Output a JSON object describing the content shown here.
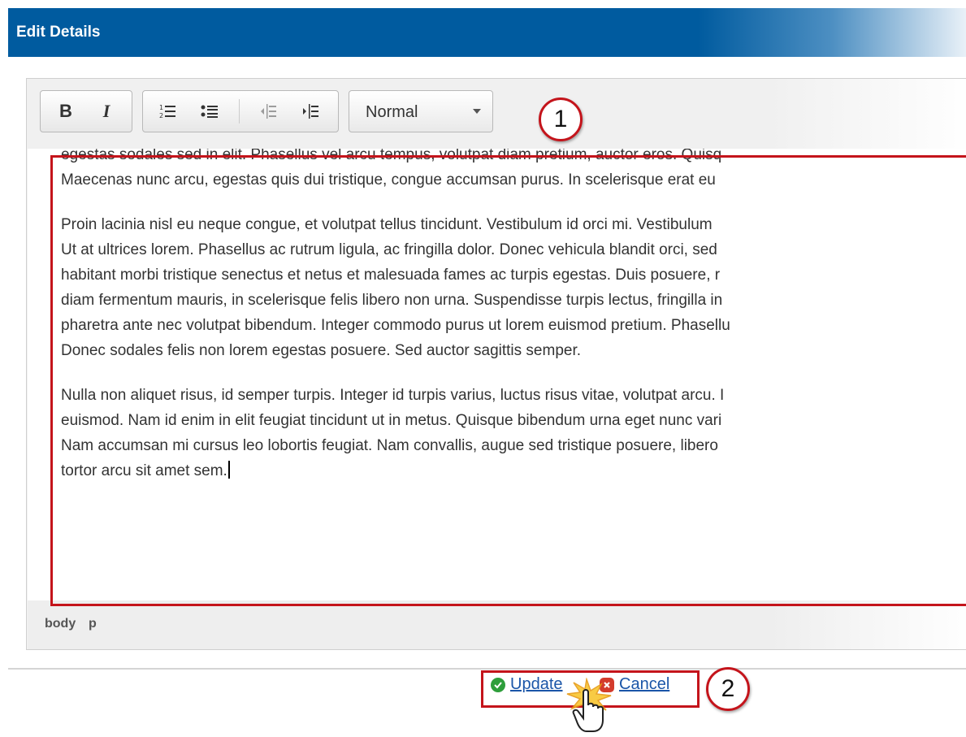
{
  "header": {
    "title": "Edit Details"
  },
  "toolbar": {
    "bold_label": "B",
    "italic_label": "I",
    "format_value": "Normal"
  },
  "callouts": {
    "first": "1",
    "second": "2"
  },
  "editor": {
    "paragraphs": [
      {
        "lines": [
          "egestas sodales sed in elit. Phasellus vel arcu tempus, volutpat diam pretium, auctor eros. Quisq",
          "Maecenas nunc arcu, egestas quis dui tristique, congue accumsan purus. In scelerisque erat eu"
        ]
      },
      {
        "lines": [
          "Proin lacinia nisl eu neque congue, et volutpat tellus tincidunt. Vestibulum id orci mi. Vestibulum",
          "Ut at ultrices lorem. Phasellus ac rutrum ligula, ac fringilla dolor. Donec vehicula blandit orci, sed",
          "habitant morbi tristique senectus et netus et malesuada fames ac turpis egestas. Duis posuere, r",
          "diam fermentum mauris, in scelerisque felis libero non urna. Suspendisse turpis lectus, fringilla in",
          "pharetra ante nec volutpat bibendum. Integer commodo purus ut lorem euismod pretium. Phasellu",
          "Donec sodales felis non lorem egestas posuere. Sed auctor sagittis semper."
        ]
      },
      {
        "lines": [
          "Nulla non aliquet risus, id semper turpis. Integer id turpis varius, luctus risus vitae, volutpat arcu. I",
          "euismod. Nam id enim in elit feugiat tincidunt ut in metus. Quisque bibendum urna eget nunc vari",
          "Nam accumsan mi cursus leo lobortis feugiat. Nam convallis, augue sed tristique posuere, libero",
          "tortor arcu sit amet sem."
        ]
      }
    ]
  },
  "statusbar": {
    "path": [
      "body",
      "p"
    ]
  },
  "actions": {
    "update_label": "Update",
    "cancel_label": "Cancel"
  },
  "colors": {
    "header_blue": "#005b9f",
    "callout_red": "#c4141b",
    "link_blue": "#1a55a8"
  }
}
